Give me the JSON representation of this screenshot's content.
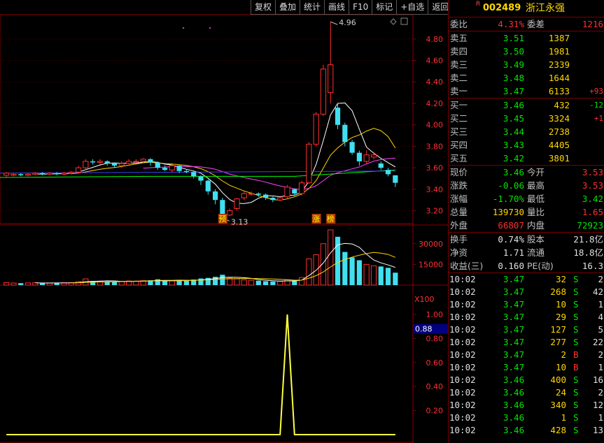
{
  "toolbar": [
    "复权",
    "叠加",
    "统计",
    "画线",
    "F10",
    "标记",
    "+自选",
    "返回"
  ],
  "stock": {
    "badge": "R",
    "code": "002489",
    "name": "浙江永强"
  },
  "weibi": {
    "label1": "委比",
    "value1": "4.31%",
    "label2": "委差",
    "value2": "1216"
  },
  "asks": [
    {
      "label": "卖五",
      "price": "3.51",
      "vol": "1387",
      "chg": ""
    },
    {
      "label": "卖四",
      "price": "3.50",
      "vol": "1981",
      "chg": ""
    },
    {
      "label": "卖三",
      "price": "3.49",
      "vol": "2339",
      "chg": ""
    },
    {
      "label": "卖二",
      "price": "3.48",
      "vol": "1644",
      "chg": ""
    },
    {
      "label": "卖一",
      "price": "3.47",
      "vol": "6133",
      "chg": "+93"
    }
  ],
  "bids": [
    {
      "label": "买一",
      "price": "3.46",
      "vol": "432",
      "chg": "-12"
    },
    {
      "label": "买二",
      "price": "3.45",
      "vol": "3324",
      "chg": "+1"
    },
    {
      "label": "买三",
      "price": "3.44",
      "vol": "2738",
      "chg": ""
    },
    {
      "label": "买四",
      "price": "3.43",
      "vol": "4405",
      "chg": ""
    },
    {
      "label": "买五",
      "price": "3.42",
      "vol": "3801",
      "chg": ""
    }
  ],
  "quote": [
    {
      "l1": "现价",
      "v1": "3.46",
      "c1": "green",
      "l2": "今开",
      "v2": "3.53",
      "c2": "red"
    },
    {
      "l1": "涨跌",
      "v1": "-0.06",
      "c1": "green",
      "l2": "最高",
      "v2": "3.53",
      "c2": "red"
    },
    {
      "l1": "涨幅",
      "v1": "-1.70%",
      "c1": "green",
      "l2": "最低",
      "v2": "3.42",
      "c2": "green"
    },
    {
      "l1": "总量",
      "v1": "139730",
      "c1": "yellow",
      "l2": "量比",
      "v2": "1.65",
      "c2": "red"
    },
    {
      "l1": "外盘",
      "v1": "66807",
      "c1": "red",
      "l2": "内盘",
      "v2": "72923",
      "c2": "green"
    }
  ],
  "fund": [
    {
      "l1": "换手",
      "v1": "0.74%",
      "l2": "股本",
      "v2": "21.8亿"
    },
    {
      "l1": "净资",
      "v1": "1.71",
      "l2": "流通",
      "v2": "18.8亿"
    },
    {
      "l1": "收益(三)",
      "v1": "0.160",
      "l2": "PE(动)",
      "v2": "16.3"
    }
  ],
  "ticks": [
    {
      "time": "10:02",
      "price": "3.47",
      "vol": "32",
      "side": "S",
      "num": "2"
    },
    {
      "time": "10:02",
      "price": "3.47",
      "vol": "268",
      "side": "S",
      "num": "42"
    },
    {
      "time": "10:02",
      "price": "3.47",
      "vol": "10",
      "side": "S",
      "num": "1"
    },
    {
      "time": "10:02",
      "price": "3.47",
      "vol": "29",
      "side": "S",
      "num": "4"
    },
    {
      "time": "10:02",
      "price": "3.47",
      "vol": "127",
      "side": "S",
      "num": "5"
    },
    {
      "time": "10:02",
      "price": "3.47",
      "vol": "277",
      "side": "S",
      "num": "22"
    },
    {
      "time": "10:02",
      "price": "3.47",
      "vol": "2",
      "side": "B",
      "num": "2"
    },
    {
      "time": "10:02",
      "price": "3.47",
      "vol": "10",
      "side": "B",
      "num": "1"
    },
    {
      "time": "10:02",
      "price": "3.46",
      "vol": "400",
      "side": "S",
      "num": "16"
    },
    {
      "time": "10:02",
      "price": "3.46",
      "vol": "24",
      "side": "S",
      "num": "2"
    },
    {
      "time": "10:02",
      "price": "3.46",
      "vol": "340",
      "side": "S",
      "num": "12"
    },
    {
      "time": "10:02",
      "price": "3.46",
      "vol": "1",
      "side": "S",
      "num": "1"
    },
    {
      "time": "10:02",
      "price": "3.46",
      "vol": "428",
      "side": "S",
      "num": "13"
    }
  ],
  "chart_data": {
    "type": "candlestick",
    "price_axis": [
      "4.80",
      "4.60",
      "4.40",
      "4.20",
      "4.00",
      "3.80",
      "3.60",
      "3.40",
      "3.20"
    ],
    "price_ticks": [
      4.8,
      4.6,
      4.4,
      4.2,
      4.0,
      3.8,
      3.6,
      3.4,
      3.2
    ],
    "ylim": [
      3.08,
      5.02
    ],
    "high_label": "4.96",
    "low_label": "3.13",
    "markers": [
      "预",
      "涨",
      "榜"
    ],
    "candles": [
      [
        3.53,
        3.55,
        3.51,
        3.56
      ],
      [
        3.53,
        3.54,
        3.52,
        3.55
      ],
      [
        3.54,
        3.53,
        3.52,
        3.55
      ],
      [
        3.53,
        3.54,
        3.52,
        3.55
      ],
      [
        3.54,
        3.55,
        3.53,
        3.56
      ],
      [
        3.55,
        3.54,
        3.53,
        3.56
      ],
      [
        3.54,
        3.55,
        3.53,
        3.56
      ],
      [
        3.55,
        3.54,
        3.53,
        3.56
      ],
      [
        3.54,
        3.55,
        3.53,
        3.56
      ],
      [
        3.55,
        3.56,
        3.54,
        3.57
      ],
      [
        3.56,
        3.6,
        3.55,
        3.62
      ],
      [
        3.6,
        3.66,
        3.58,
        3.68
      ],
      [
        3.66,
        3.65,
        3.63,
        3.68
      ],
      [
        3.65,
        3.66,
        3.63,
        3.68
      ],
      [
        3.66,
        3.64,
        3.62,
        3.67
      ],
      [
        3.64,
        3.62,
        3.6,
        3.65
      ],
      [
        3.62,
        3.64,
        3.6,
        3.66
      ],
      [
        3.64,
        3.66,
        3.62,
        3.68
      ],
      [
        3.66,
        3.66,
        3.64,
        3.68
      ],
      [
        3.66,
        3.68,
        3.64,
        3.69
      ],
      [
        3.68,
        3.65,
        3.62,
        3.69
      ],
      [
        3.65,
        3.6,
        3.58,
        3.66
      ],
      [
        3.6,
        3.58,
        3.57,
        3.62
      ],
      [
        3.58,
        3.62,
        3.56,
        3.63
      ],
      [
        3.62,
        3.57,
        3.55,
        3.63
      ],
      [
        3.57,
        3.56,
        3.55,
        3.58
      ],
      [
        3.56,
        3.52,
        3.5,
        3.57
      ],
      [
        3.52,
        3.48,
        3.44,
        3.53
      ],
      [
        3.48,
        3.38,
        3.35,
        3.49
      ],
      [
        3.38,
        3.3,
        3.26,
        3.4
      ],
      [
        3.3,
        3.16,
        3.13,
        3.32
      ],
      [
        3.16,
        3.2,
        3.15,
        3.22
      ],
      [
        3.22,
        3.31,
        3.2,
        3.32
      ],
      [
        3.32,
        3.36,
        3.3,
        3.38
      ],
      [
        3.36,
        3.36,
        3.34,
        3.38
      ],
      [
        3.36,
        3.35,
        3.33,
        3.37
      ],
      [
        3.35,
        3.32,
        3.3,
        3.36
      ],
      [
        3.32,
        3.3,
        3.28,
        3.33
      ],
      [
        3.3,
        3.32,
        3.29,
        3.34
      ],
      [
        3.33,
        3.42,
        3.31,
        3.44
      ],
      [
        3.4,
        3.36,
        3.34,
        3.41
      ],
      [
        3.36,
        3.46,
        3.34,
        3.48
      ],
      [
        3.46,
        3.82,
        3.45,
        3.84
      ],
      [
        3.82,
        4.1,
        3.8,
        4.12
      ],
      [
        4.1,
        4.52,
        4.08,
        4.56
      ],
      [
        4.3,
        4.56,
        4.2,
        4.96
      ],
      [
        4.16,
        4.0,
        3.96,
        4.2
      ],
      [
        4.0,
        3.84,
        3.8,
        4.02
      ],
      [
        3.84,
        3.74,
        3.72,
        3.86
      ],
      [
        3.74,
        3.66,
        3.62,
        3.76
      ],
      [
        3.66,
        3.72,
        3.64,
        3.76
      ],
      [
        3.7,
        3.72,
        3.68,
        3.75
      ],
      [
        3.64,
        3.6,
        3.58,
        3.66
      ],
      [
        3.58,
        3.54,
        3.52,
        3.6
      ],
      [
        3.53,
        3.46,
        3.42,
        3.53
      ]
    ],
    "vol_axis": [
      "30000",
      "15000"
    ],
    "vol_ticks": [
      30000,
      15000
    ],
    "vol_max": 40000,
    "volumes": [
      1800,
      1500,
      1400,
      1600,
      1700,
      1500,
      1400,
      1600,
      1700,
      1800,
      2500,
      4500,
      3000,
      2800,
      2600,
      2400,
      2700,
      3000,
      2900,
      3200,
      3500,
      4200,
      3300,
      3100,
      3500,
      3400,
      4000,
      4800,
      5200,
      6000,
      7500,
      5000,
      4500,
      3800,
      3500,
      3200,
      2800,
      2600,
      2700,
      3800,
      3400,
      5500,
      19000,
      22000,
      30000,
      40000,
      35000,
      24000,
      20000,
      18000,
      15000,
      14000,
      13500,
      12500,
      9000
    ],
    "vol_multiplier": "X100",
    "indicator_axis": [
      "1.00",
      "0.80",
      "0.60",
      "0.40",
      "0.20"
    ],
    "indicator_ticks": [
      1.0,
      0.8,
      0.6,
      0.4,
      0.2
    ],
    "indicator_current": "0.88",
    "indicator_values": [
      0,
      0,
      0,
      0,
      0,
      0,
      0,
      0,
      0,
      0,
      0,
      0,
      0,
      0,
      0,
      0,
      0,
      0,
      0,
      0,
      0,
      0,
      0,
      0,
      0,
      0,
      0,
      0,
      0,
      0,
      0,
      0,
      0,
      0,
      0,
      0,
      0,
      0,
      0,
      1.0,
      0,
      0,
      0,
      0,
      0,
      0,
      0,
      0,
      0,
      0,
      0,
      0,
      0,
      0,
      0
    ]
  }
}
